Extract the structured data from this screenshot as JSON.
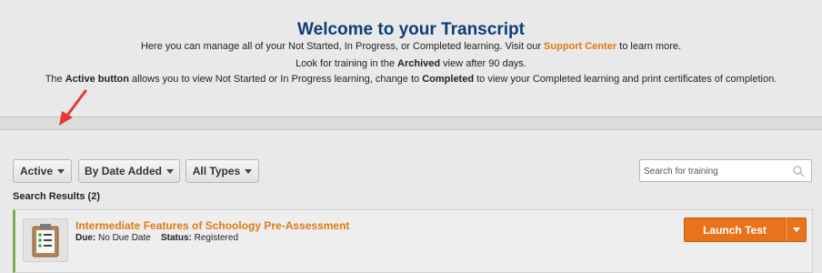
{
  "header": {
    "title": "Welcome to your Transcript",
    "line1_prefix": "Here you can manage all of your Not Started, In Progress, or Completed learning. Visit our ",
    "support_link": "Support Center",
    "line1_suffix": " to learn more.",
    "line2_prefix": "Look for training in the ",
    "line2_bold": "Archived",
    "line2_suffix": " view after 90 days.",
    "line3_prefix": "The ",
    "line3_bold1": "Active button",
    "line3_mid": " allows you to view Not Started or In Progress learning, change to ",
    "line3_bold2": "Completed",
    "line3_suffix": " to view your Completed learning and print certificates of completion."
  },
  "filters": {
    "status": "Active",
    "sort": "By Date Added",
    "type": "All Types"
  },
  "search": {
    "placeholder": "Search for training",
    "value": ""
  },
  "results": {
    "label": "Search Results (2)"
  },
  "items": [
    {
      "title": "Intermediate Features of Schoology Pre-Assessment",
      "due_label": "Due:",
      "due_value": "No Due Date",
      "status_label": "Status:",
      "status_value": "Registered",
      "action": "Launch Test",
      "thumb_icon": "clipboard-checklist-icon"
    }
  ],
  "colors": {
    "title": "#0b3e7a",
    "link": "#e07b13",
    "action": "#e8731b",
    "accent_border": "#7fae52",
    "annotation_arrow": "#e53935"
  }
}
